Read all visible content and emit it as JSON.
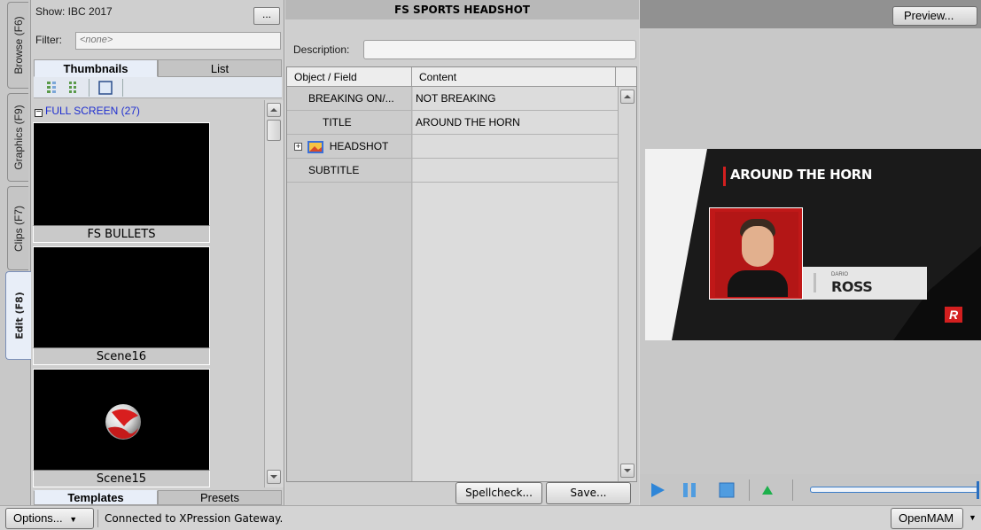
{
  "vtabs": [
    {
      "label": "Browse (F6)"
    },
    {
      "label": "Graphics (F9)"
    },
    {
      "label": "Clips (F7)"
    },
    {
      "label": "Edit (F8)"
    }
  ],
  "browser": {
    "show_label": "Show: IBC 2017",
    "more_label": "...",
    "filter_label": "Filter:",
    "filter_placeholder": "<none>",
    "tabs": [
      {
        "label": "Thumbnails"
      },
      {
        "label": "List"
      }
    ],
    "group_label": "FULL SCREEN (27)",
    "thumbnails": [
      {
        "label": "FS BULLETS"
      },
      {
        "label": "Scene16"
      },
      {
        "label": "Scene15"
      }
    ],
    "bottom_tabs": [
      {
        "label": "Templates"
      },
      {
        "label": "Presets"
      }
    ]
  },
  "editor": {
    "title": "FS SPORTS HEADSHOT",
    "description_label": "Description:",
    "description_value": "",
    "columns": [
      "Object / Field",
      "Content"
    ],
    "rows": [
      {
        "field": "BREAKING ON/...",
        "content": "NOT BREAKING"
      },
      {
        "field": "TITLE",
        "content": "AROUND THE HORN"
      },
      {
        "field": "HEADSHOT",
        "content": ""
      },
      {
        "field": "SUBTITLE",
        "content": ""
      }
    ],
    "spellcheck_label": "Spellcheck...",
    "save_label": "Save..."
  },
  "preview": {
    "button_label": "Preview...",
    "graphic_title": "AROUND THE HORN",
    "name_first": "DARIO",
    "name_last": "ROSS",
    "logo_letter": "R"
  },
  "status": {
    "options_label": "Options...",
    "message": "Connected to XPression Gateway.",
    "openmam_label": "OpenMAM"
  }
}
